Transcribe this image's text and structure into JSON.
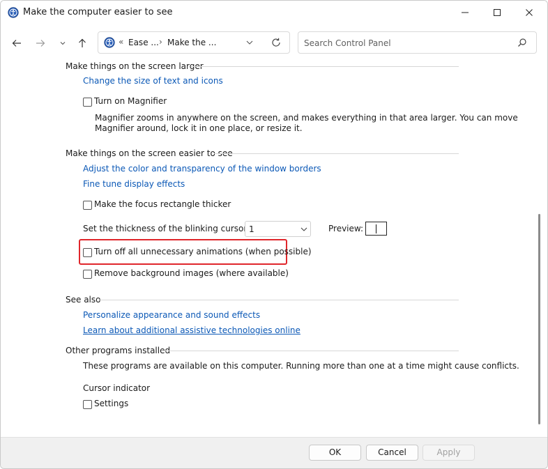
{
  "window": {
    "title": "Make the computer easier to see"
  },
  "address_bar": {
    "overflow": "«",
    "crumb_1": "Ease ...",
    "separator": "›",
    "crumb_2": "Make the ..."
  },
  "search": {
    "placeholder": "Search Control Panel"
  },
  "sections": {
    "larger": {
      "heading": "Make things on the screen larger",
      "link_text_size": "Change the size of text and icons",
      "magnifier_label": "Turn on Magnifier",
      "magnifier_desc_1": "Magnifier zooms in anywhere on the screen, and makes everything in that area larger. You can move",
      "magnifier_desc_2": "Magnifier around, lock it in one place, or resize it."
    },
    "easier": {
      "heading": "Make things on the screen easier to see",
      "link_color": "Adjust the color and transparency of the window borders",
      "link_display": "Fine tune display effects",
      "focus_label": "Make the focus rectangle thicker",
      "cursor_label": "Set the thickness of the blinking cursor:",
      "cursor_value": "1",
      "preview_label": "Preview:",
      "animations_label": "Turn off all unnecessary animations (when possible)",
      "background_label": "Remove background images (where available)"
    },
    "see_also": {
      "heading": "See also",
      "link_personalize": "Personalize appearance and sound effects",
      "link_learn": "Learn about additional assistive technologies online"
    },
    "other": {
      "heading": "Other programs installed",
      "desc": "These programs are available on this computer. Running more than one at a time might cause conflicts.",
      "cursor_indicator": "Cursor indicator",
      "settings_label": "Settings"
    }
  },
  "footer": {
    "ok": "OK",
    "cancel": "Cancel",
    "apply": "Apply"
  },
  "colors": {
    "link": "#0b58b6",
    "highlight": "#e0262b"
  }
}
